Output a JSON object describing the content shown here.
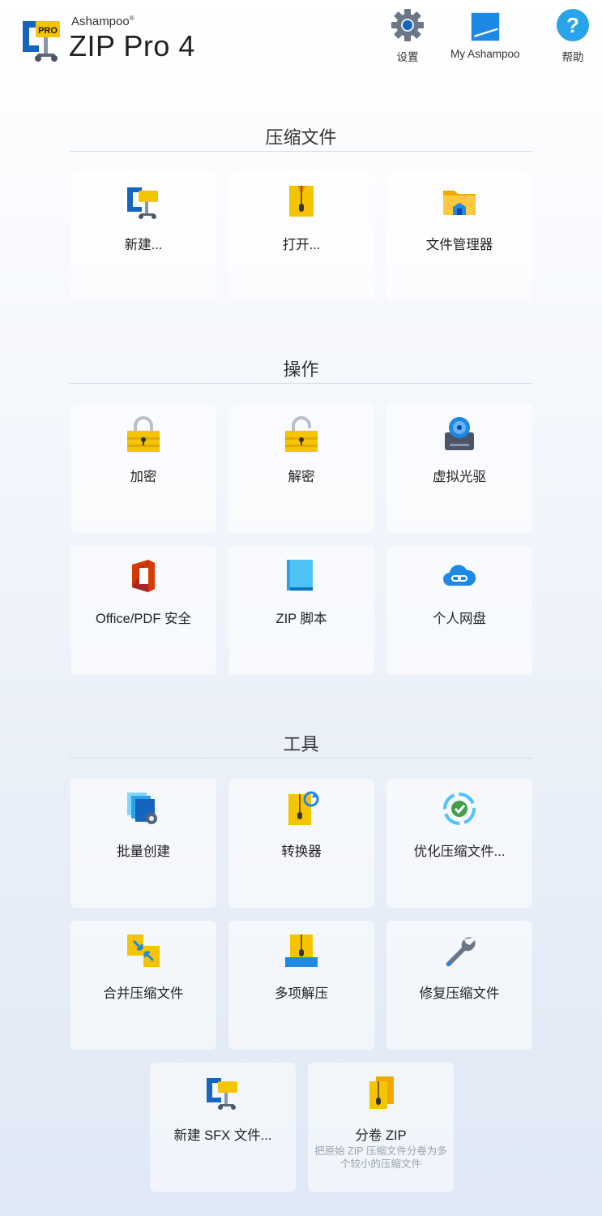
{
  "header": {
    "brand_small": "Ashampoo",
    "brand_reg": "®",
    "brand_main": "ZIP Pro 4",
    "logo_badge": "PRO",
    "buttons": {
      "settings": "设置",
      "my_ashampoo": "My Ashampoo",
      "help": "帮助"
    },
    "help_glyph": "?"
  },
  "sections": {
    "compress": {
      "title": "压缩文件",
      "tiles": {
        "new": "新建...",
        "open": "打开...",
        "file_manager": "文件管理器"
      }
    },
    "operations": {
      "title": "操作",
      "tiles": {
        "encrypt": "加密",
        "decrypt": "解密",
        "virtual_drive": "虚拟光驱",
        "office_pdf": "Office/PDF 安全",
        "zip_script": "ZIP 脚本",
        "personal_cloud": "个人网盘"
      }
    },
    "tools": {
      "title": "工具",
      "tiles": {
        "batch_create": "批量创建",
        "converter": "转换器",
        "optimize": "优化压缩文件...",
        "merge": "合并压缩文件",
        "multi_extract": "多项解压",
        "repair": "修复压缩文件",
        "new_sfx": "新建 SFX 文件...",
        "split_zip": "分卷 ZIP",
        "split_zip_desc": "把原始 ZIP 压缩文件分卷为多个较小的压缩文件"
      }
    }
  },
  "colors": {
    "accent_blue": "#1e88e5",
    "zip_yellow": "#f5c400",
    "office_red": "#d83b01"
  }
}
